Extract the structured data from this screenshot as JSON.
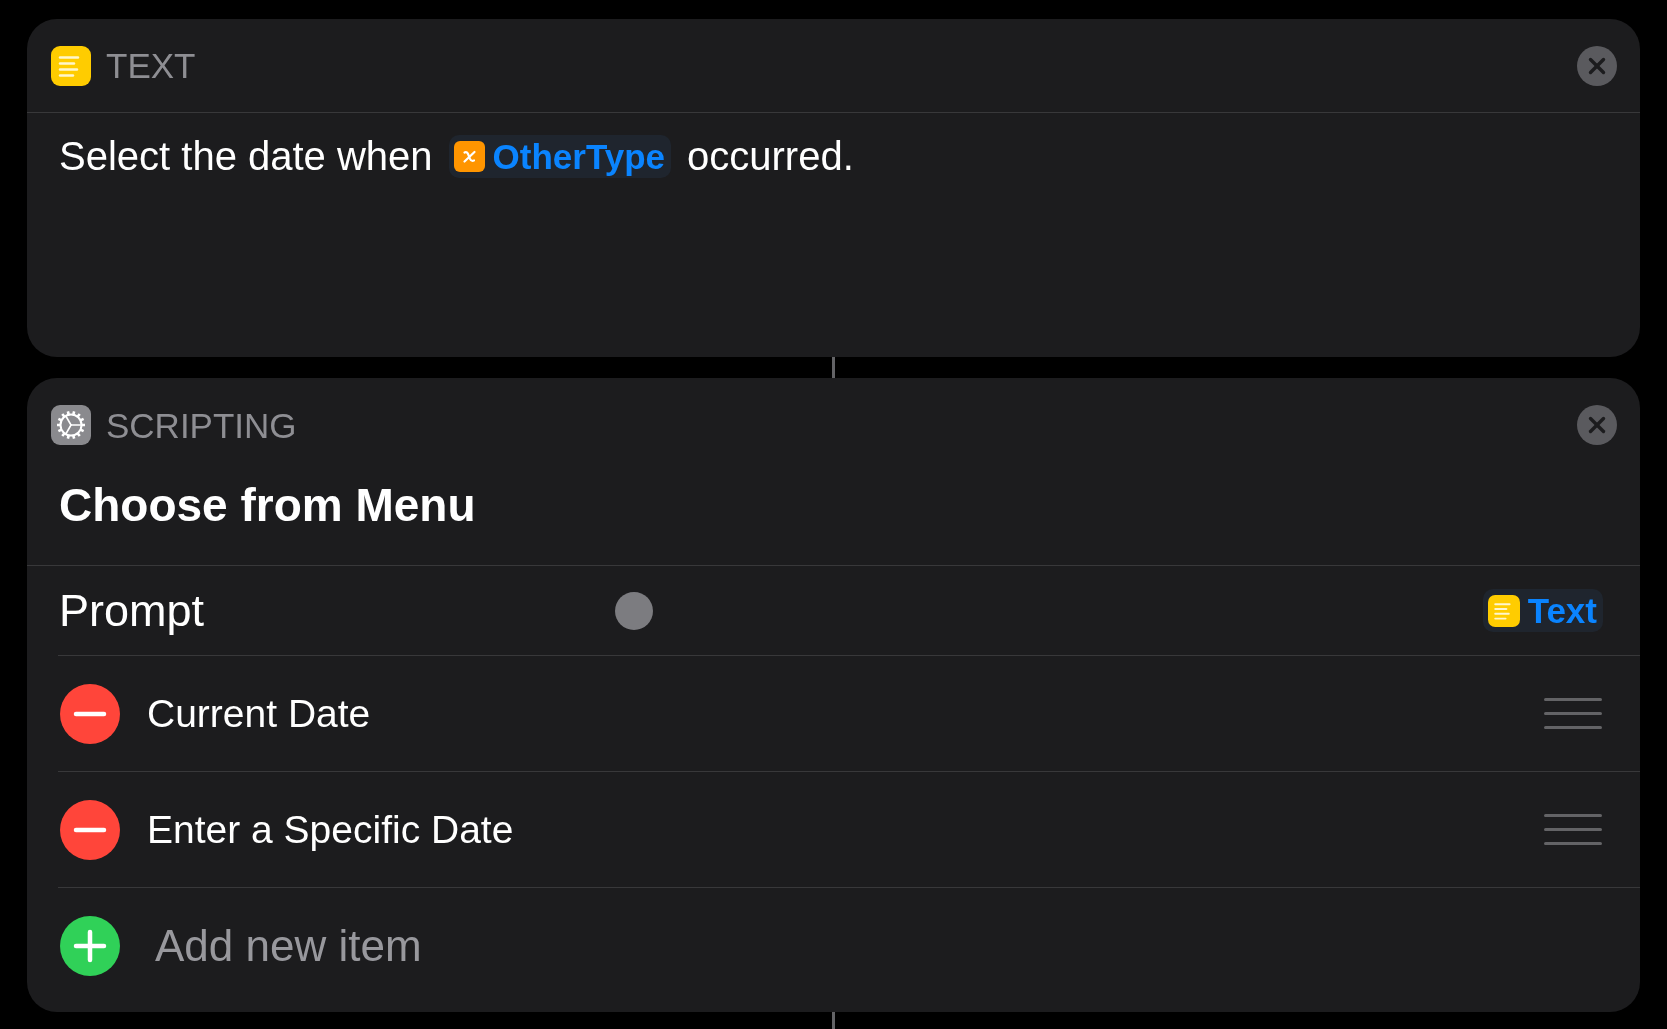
{
  "actions": [
    {
      "kind": "text",
      "category": "TEXT",
      "content": [
        {
          "kind": "plain",
          "text": "Select the date when"
        },
        {
          "kind": "variable",
          "text": "OtherType"
        },
        {
          "kind": "plain",
          "text": "occurred."
        }
      ]
    },
    {
      "kind": "menu",
      "category": "SCRIPTING",
      "title": "Choose from Menu",
      "prompt": {
        "label": "Prompt",
        "token": {
          "kind": "text",
          "text": "Text"
        }
      },
      "items": [
        {
          "label": "Current Date"
        },
        {
          "label": "Enter a Specific Date"
        }
      ],
      "add_item": "Add new item"
    }
  ]
}
